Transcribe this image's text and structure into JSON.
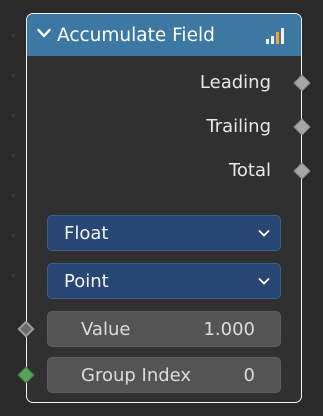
{
  "node": {
    "title": "Accumulate Field",
    "header_color": "#3d78a3",
    "collapse_icon": "chevron-down-icon",
    "field_icon": "field-bars-icon",
    "outputs": [
      {
        "label": "Leading"
      },
      {
        "label": "Trailing"
      },
      {
        "label": "Total"
      }
    ],
    "data_type": {
      "selected": "Float"
    },
    "domain": {
      "selected": "Point"
    },
    "inputs": [
      {
        "label": "Value",
        "value": "1.000"
      },
      {
        "label": "Group Index",
        "value": "0"
      }
    ]
  }
}
